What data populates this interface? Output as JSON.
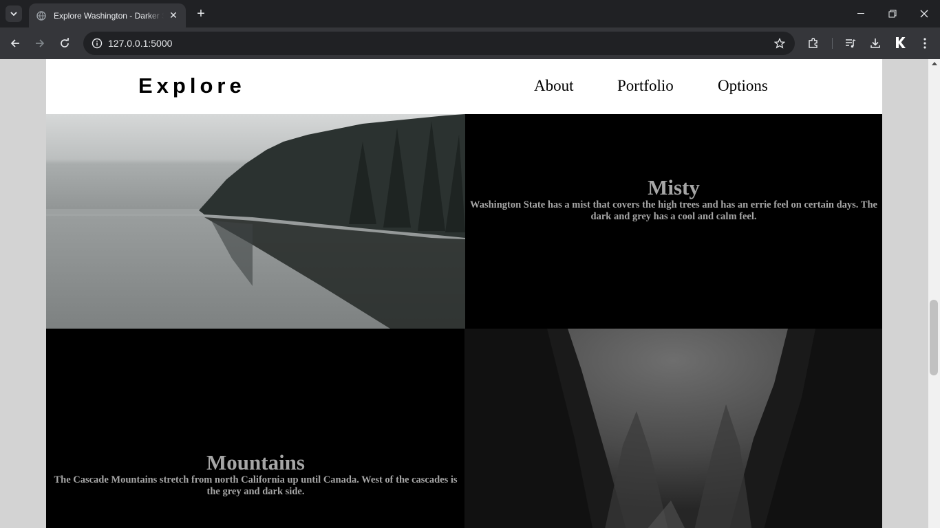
{
  "browser": {
    "tab_title": "Explore Washington - Darker Side",
    "url": "127.0.0.1:5000"
  },
  "site": {
    "brand": "Explore",
    "nav": [
      "About",
      "Portfolio",
      "Options"
    ]
  },
  "sections": [
    {
      "heading": "Misty",
      "text": "Washington State has a mist that covers the high trees and has an errie feel on certain days. The dark and grey has a cool and calm feel."
    },
    {
      "heading": "Mountains",
      "text": "The Cascade Mountains stretch from north California up until Canada. West of the cascades is the grey and dark side."
    }
  ]
}
